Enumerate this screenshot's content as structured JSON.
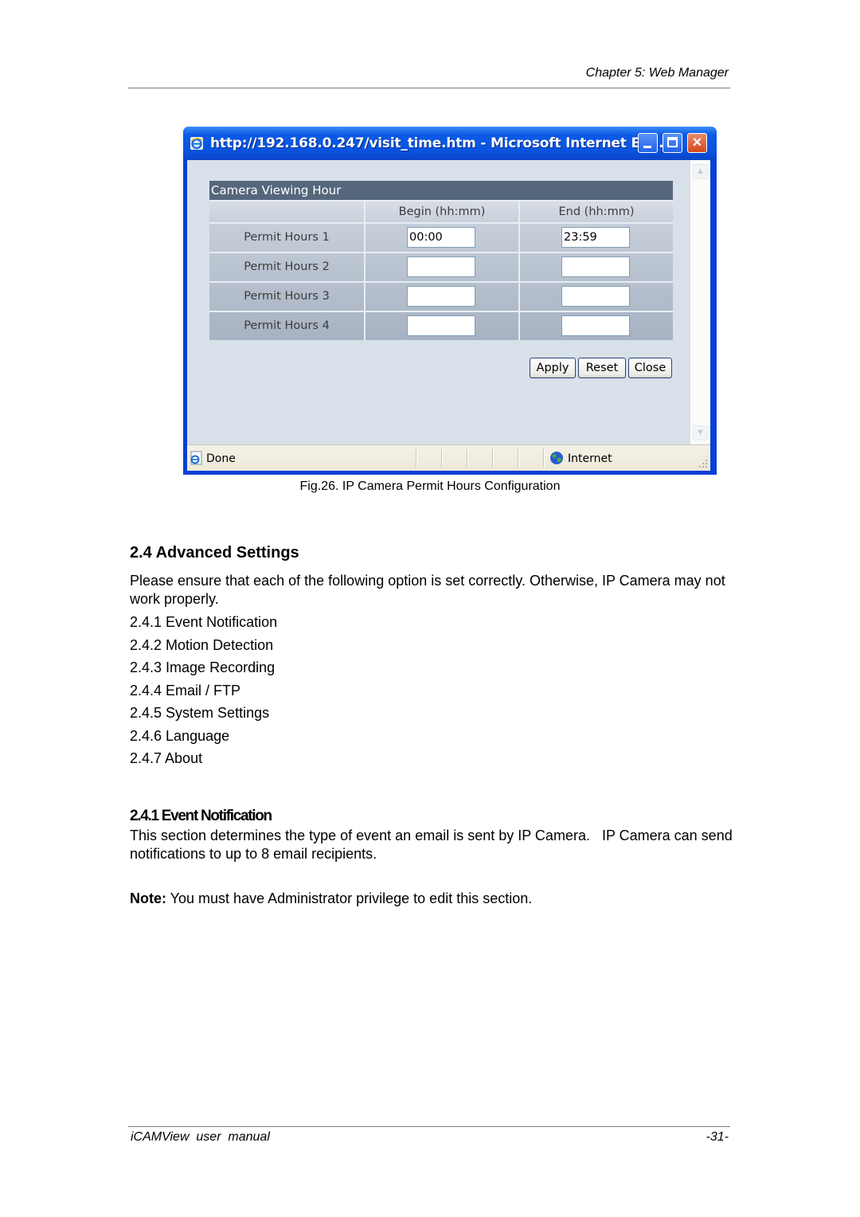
{
  "page_header": {
    "chapter": "Chapter 5: Web Manager"
  },
  "browser_window": {
    "title": "http://192.168.0.247/visit_time.htm - Microsoft Internet Ex...",
    "title_icon": "ie-logo-icon",
    "controls": {
      "minimize": "minimize-icon",
      "maximize": "maximize-icon",
      "close": "×"
    },
    "form": {
      "title": "Camera Viewing Hour",
      "columns": [
        "",
        "Begin (hh:mm)",
        "End (hh:mm)"
      ],
      "rows": [
        {
          "label": "Permit Hours 1",
          "begin": "00:00",
          "end": "23:59"
        },
        {
          "label": "Permit Hours 2",
          "begin": "",
          "end": ""
        },
        {
          "label": "Permit Hours 3",
          "begin": "",
          "end": ""
        },
        {
          "label": "Permit Hours 4",
          "begin": "",
          "end": ""
        }
      ],
      "buttons": {
        "apply": "Apply",
        "reset": "Reset",
        "close": "Close"
      }
    },
    "statusbar": {
      "status": "Done",
      "zone": "Internet"
    },
    "colors": {
      "titlebar": "#0b5ae6",
      "form_header": "#56677d",
      "client_bg": "#d8e0ea"
    }
  },
  "figure_caption": "Fig.26.  IP Camera Permit Hours Configuration",
  "section": {
    "heading": "2.4 Advanced Settings",
    "intro": "Please ensure that each of the following option is set correctly. Otherwise, IP Camera may not work properly.",
    "items": [
      "2.4.1 Event Notification",
      "2.4.2 Motion Detection",
      "2.4.3 Image Recording",
      "2.4.4 Email / FTP",
      "2.4.5 System Settings",
      "2.4.6 Language",
      "2.4.7 About"
    ]
  },
  "subsection": {
    "heading": "2.4.1 Event Notification",
    "body": "This section determines the type of event an email is sent by IP Camera.   IP Camera can send notifications to up to 8 email recipients.",
    "note_label": "Note:",
    "note_text": " You must have Administrator privilege to edit this section."
  },
  "page_footer": {
    "manual": "iCAMView  user  manual",
    "page": "-31-"
  }
}
